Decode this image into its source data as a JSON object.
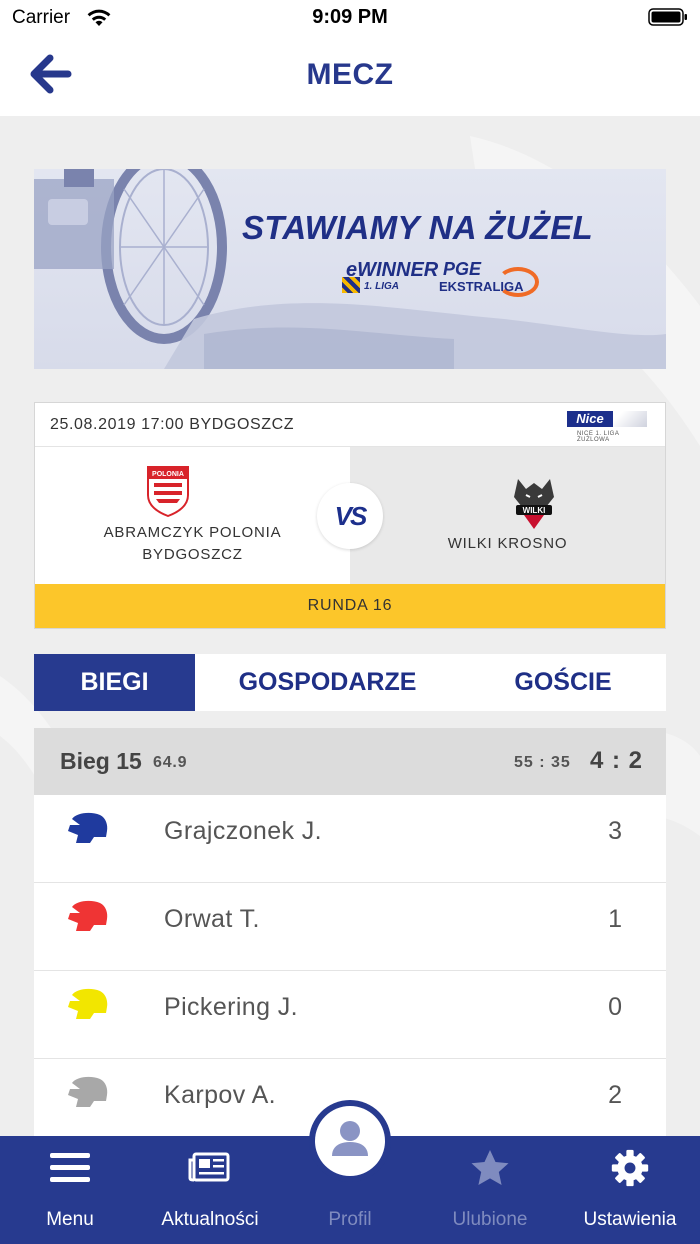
{
  "status_bar": {
    "carrier": "Carrier",
    "time": "9:09 PM"
  },
  "nav": {
    "title": "MECZ",
    "back_icon": "arrow-left-icon"
  },
  "banner": {
    "headline": "STAWIAMY NA ŻUŻEL",
    "logo_1_text": "eWINNER",
    "logo_1_sub": "1. LIGA",
    "logo_2_text": "PGE",
    "logo_2_sub": "EKSTRALIGA"
  },
  "match": {
    "datetime_place": "25.08.2019 17:00 BYDGOSZCZ",
    "league_logo_text": "Nice",
    "league_logo_sub": "NICE 1. LIGA ŻUŻLOWA",
    "home": {
      "name_line1": "ABRAMCZYK POLONIA",
      "name_line2": "BYDGOSZCZ",
      "logo_text": "POLONIA"
    },
    "away": {
      "name": "WILKI KROSNO",
      "logo_text": "WILKI"
    },
    "vs": "VS",
    "round": "RUNDA 16"
  },
  "tabs": [
    {
      "label": "BIEGI",
      "active": true
    },
    {
      "label": "GOSPODARZE",
      "active": false
    },
    {
      "label": "GOŚCIE",
      "active": false
    }
  ],
  "heat": {
    "name": "Bieg 15",
    "time": "64.9",
    "total": "55 : 35",
    "score": "4 : 2",
    "riders": [
      {
        "name": "Grajczonek J.",
        "points": "3",
        "helmet_color": "#1f3a9e",
        "helmet_icon": "helmet-icon"
      },
      {
        "name": "Orwat T.",
        "points": "1",
        "helmet_color": "#ef3434",
        "helmet_icon": "helmet-icon"
      },
      {
        "name": "Pickering J.",
        "points": "0",
        "helmet_color": "#f2e600",
        "helmet_icon": "helmet-icon"
      },
      {
        "name": "Karpov A.",
        "points": "2",
        "helmet_color": "#a8a8a8",
        "helmet_icon": "helmet-icon"
      }
    ]
  },
  "tabbar": [
    {
      "label": "Menu",
      "icon": "hamburger-icon",
      "active": true
    },
    {
      "label": "Aktualności",
      "icon": "newspaper-icon",
      "active": true
    },
    {
      "label": "Profil",
      "icon": "user-icon",
      "active": false
    },
    {
      "label": "Ulubione",
      "icon": "star-icon",
      "active": false
    },
    {
      "label": "Ustawienia",
      "icon": "gear-icon",
      "active": true
    }
  ],
  "colors": {
    "brand_blue": "#273a8f",
    "accent_yellow": "#fcc62a",
    "title_blue": "#27388c"
  }
}
